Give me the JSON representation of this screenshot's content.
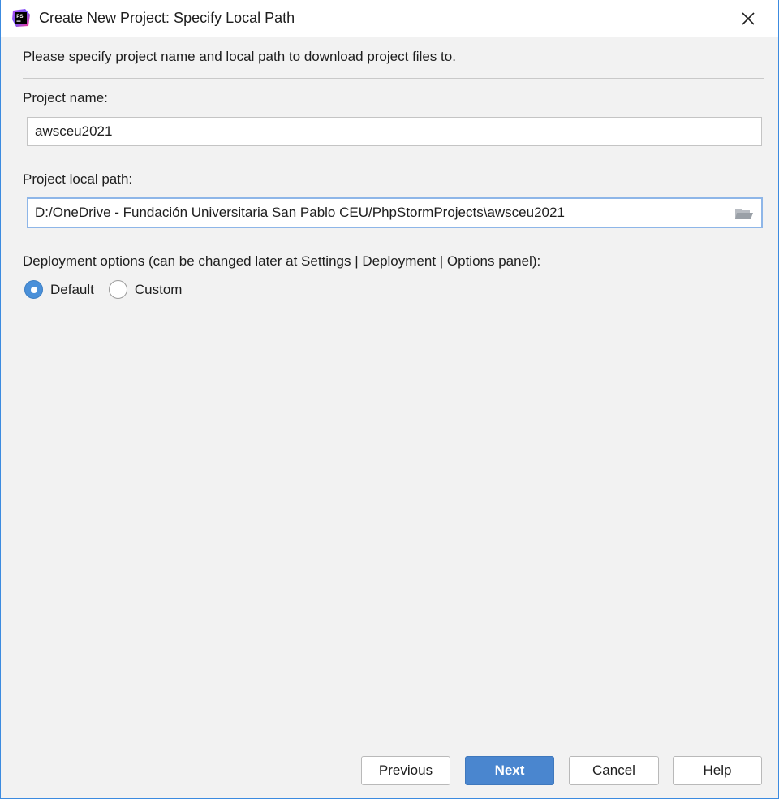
{
  "window": {
    "title": "Create New Project: Specify Local Path",
    "app_icon_text": "PS"
  },
  "intro_text": "Please specify project name and local path to download project files to.",
  "project_name": {
    "label": "Project name:",
    "value": "awsceu2021"
  },
  "project_path": {
    "label": "Project local path:",
    "value": "D:/OneDrive - Fundación Universitaria San Pablo CEU/PhpStormProjects\\awsceu2021"
  },
  "deployment": {
    "label": "Deployment options (can be changed later at Settings | Deployment | Options panel):",
    "options": [
      {
        "label": "Default",
        "selected": true
      },
      {
        "label": "Custom",
        "selected": false
      }
    ]
  },
  "buttons": {
    "previous": "Previous",
    "next": "Next",
    "cancel": "Cancel",
    "help": "Help"
  },
  "colors": {
    "accent": "#4a86cf",
    "focus_border": "#8eb6e8",
    "window_border": "#3c8be0"
  }
}
